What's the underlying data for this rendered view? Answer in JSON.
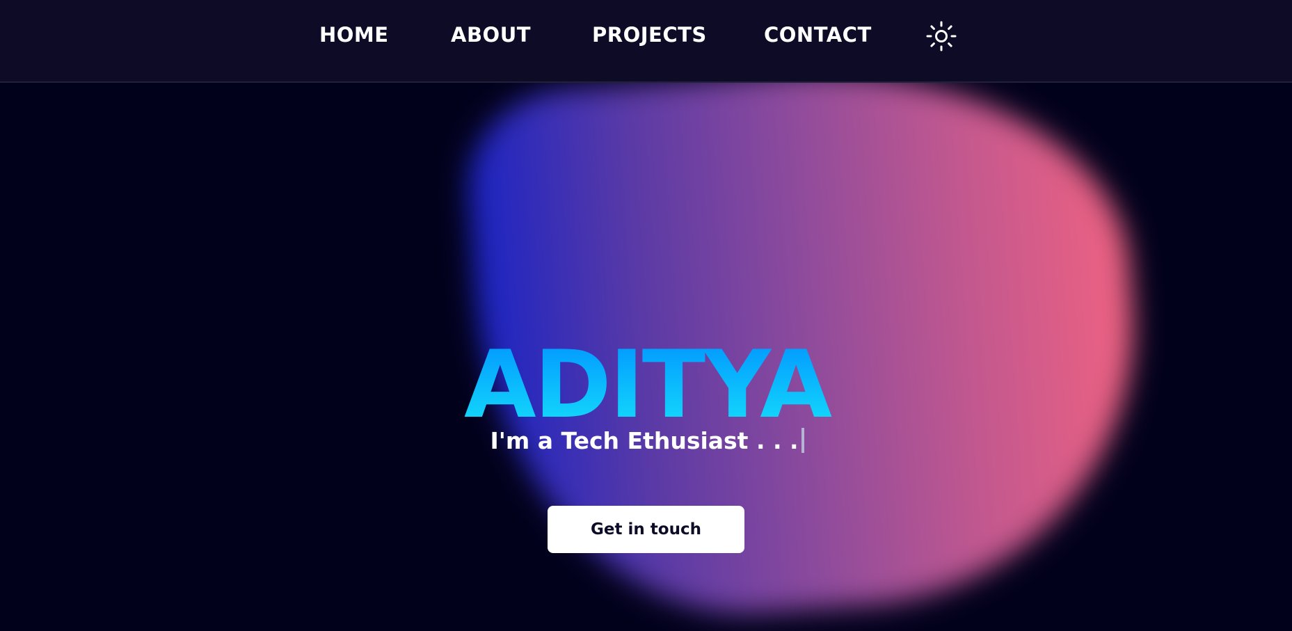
{
  "nav": {
    "home": "HOME",
    "about": "ABOUT",
    "projects": "PROJECTS",
    "contact": "CONTACT",
    "theme_icon": "sun-icon"
  },
  "hero": {
    "name": "ADITYA",
    "tagline": "I'm a Tech Ethusiast . . .",
    "cta_label": "Get in touch"
  },
  "colors": {
    "background": "#02011c",
    "navbar": "#0d0b26",
    "name_gradient_top": "#0092ff",
    "name_gradient_bottom": "#16e2fb",
    "blob_left": "#1a24c4",
    "blob_right": "#ef6281",
    "button_bg": "#ffffff",
    "button_text": "#0d0b26"
  }
}
